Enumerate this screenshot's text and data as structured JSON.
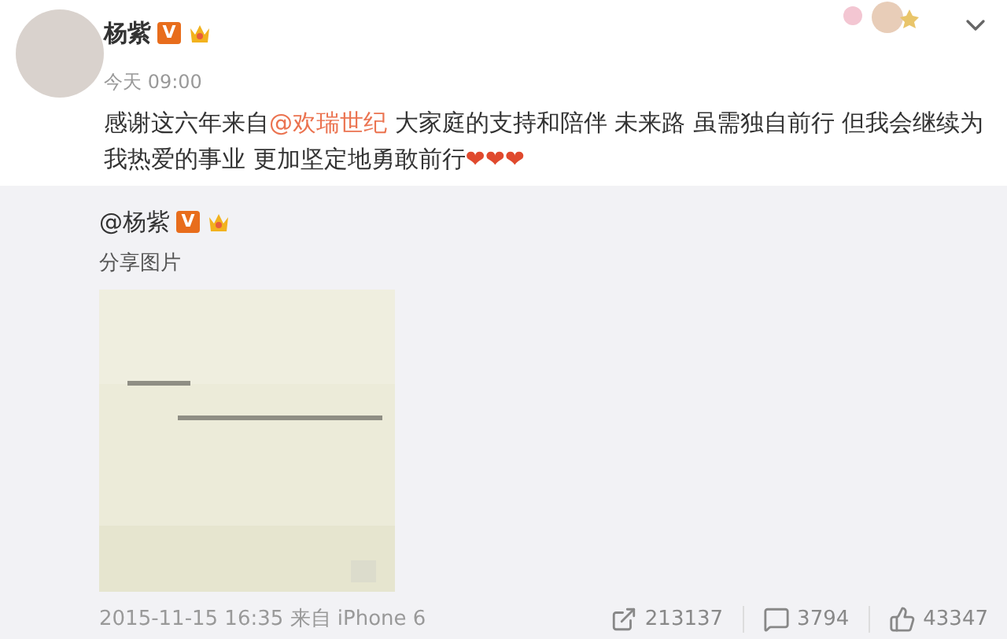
{
  "post": {
    "author": "杨紫",
    "verified_badge": "V",
    "time": "今天 09:00",
    "text": [
      {
        "kind": "plain",
        "text": "感谢这六年来自"
      },
      {
        "kind": "mention",
        "text": "@欢瑞世纪"
      },
      {
        "kind": "plain",
        "text": " 大家庭的支持和陪伴 未来路 虽需独自前行 但我会继续为我热爱的事业 更加坚定地勇敢前行"
      },
      {
        "kind": "hearts",
        "text": "❤❤❤"
      }
    ]
  },
  "repost": {
    "author": "@杨紫",
    "verified_badge": "V",
    "caption": "分享图片",
    "footer": {
      "date": "2015-11-15 16:35 来自 iPhone 6",
      "actions": [
        {
          "kind": "share",
          "count": "213137"
        },
        {
          "kind": "comment",
          "count": "3794"
        },
        {
          "kind": "like",
          "count": "43347"
        }
      ]
    }
  }
}
